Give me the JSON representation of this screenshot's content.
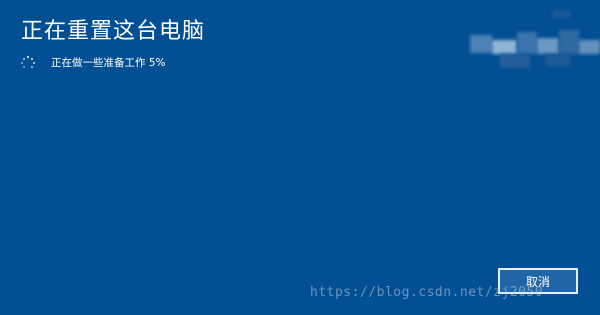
{
  "window": {
    "title": "正在重置这台电脑"
  },
  "status": {
    "text": "正在做一些准备工作 5%",
    "progress_percent": 5,
    "spinner_icon": "loading-spinner-icon"
  },
  "actions": {
    "cancel_label": "取消"
  },
  "watermark": {
    "text": "https://blog.csdn.net/zj2050"
  },
  "colors": {
    "background": "#034f94",
    "text": "#ffffff",
    "button_border": "#e6eef7"
  }
}
